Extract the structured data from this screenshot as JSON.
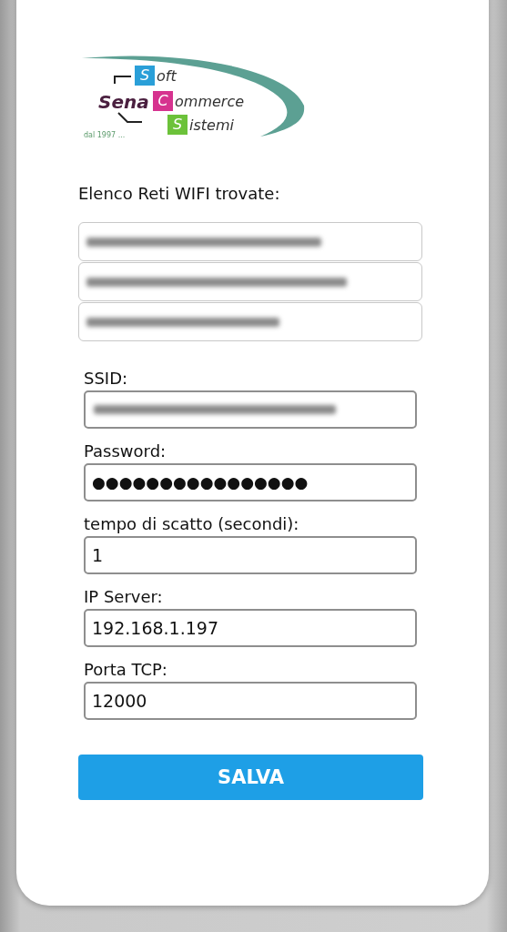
{
  "logo": {
    "name": "Sena",
    "lines": [
      {
        "initial": "S",
        "rest": "oft",
        "color": "#2a9fd8"
      },
      {
        "initial": "C",
        "rest": "ommerce",
        "color": "#d6338f"
      },
      {
        "initial": "S",
        "rest": "istemi",
        "color": "#6cc23a"
      }
    ],
    "tagline": "dal 1997 ..."
  },
  "networks": {
    "title": "Elenco Reti WIFI trovate:",
    "items": [
      {
        "kind": "blurred"
      },
      {
        "kind": "blurred"
      },
      {
        "kind": "blurred"
      }
    ]
  },
  "fields": [
    {
      "label": "SSID:",
      "kind": "blurred"
    },
    {
      "label": "Password:",
      "kind": "password",
      "value": "●●●●●●●●●●●●●●●●"
    },
    {
      "label": "tempo di scatto (secondi):",
      "kind": "text",
      "value": "1"
    },
    {
      "label": "IP Server:",
      "kind": "text",
      "value": "192.168.1.197"
    },
    {
      "label": "Porta TCP:",
      "kind": "text",
      "value": "12000"
    }
  ],
  "save_button": "SALVA"
}
